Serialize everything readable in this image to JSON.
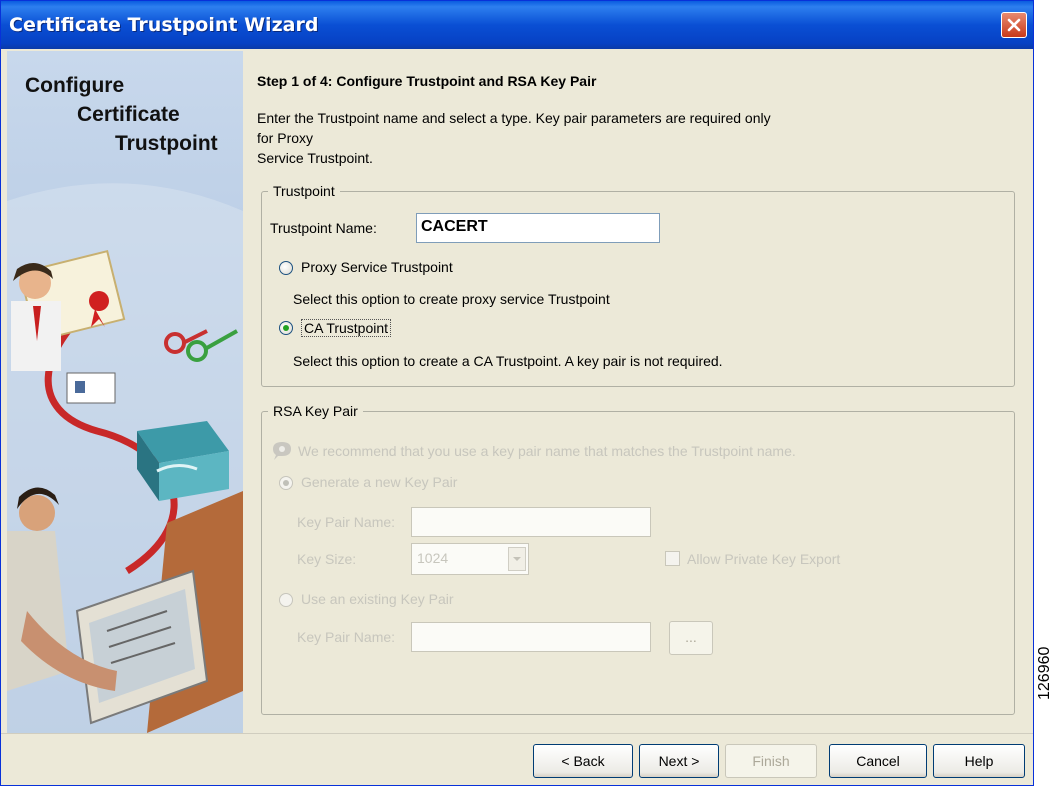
{
  "window": {
    "title": "Certificate Trustpoint Wizard"
  },
  "left": {
    "title_lines": [
      "Configure",
      "Certificate",
      "Trustpoint"
    ]
  },
  "step": {
    "title": "Step 1 of 4: Configure Trustpoint and RSA Key Pair",
    "description_lines": [
      "Enter the Trustpoint name and select a type. Key pair parameters are required only",
      "for Proxy",
      "Service Trustpoint."
    ]
  },
  "trustpoint": {
    "legend": "Trustpoint",
    "name_label": "Trustpoint Name:",
    "name_value": "CACERT",
    "proxy_label": "Proxy Service Trustpoint",
    "proxy_desc": "Select this option to create proxy service Trustpoint",
    "ca_label": "CA Trustpoint",
    "ca_desc": "Select this option to create a CA Trustpoint. A key pair is not required.",
    "selected": "ca"
  },
  "rsa": {
    "legend": "RSA Key Pair",
    "hint": "We recommend that you use a key pair name that matches the Trustpoint name.",
    "generate_label": "Generate a new Key Pair",
    "key_pair_name_label": "Key Pair Name:",
    "key_size_label": "Key Size:",
    "key_size_value": "1024",
    "allow_export_label": "Allow Private Key Export",
    "use_existing_label": "Use an existing Key Pair",
    "existing_key_pair_name_label": "Key Pair Name:",
    "browse_label": "..."
  },
  "buttons": {
    "back": "< Back",
    "next": "Next >",
    "finish": "Finish",
    "cancel": "Cancel",
    "help": "Help"
  },
  "figure_number": "126960",
  "colors": {
    "title_bar": "#0a4fd4",
    "dialog_bg": "#ece9d8",
    "disabled_text": "#c7c6bd"
  }
}
